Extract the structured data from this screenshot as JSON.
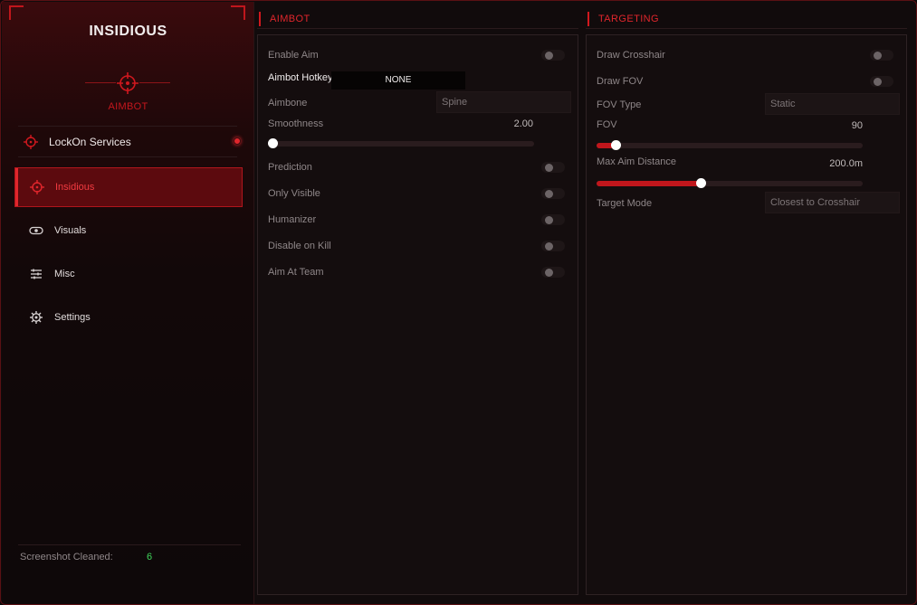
{
  "sidebar": {
    "brand": "INSIDIOUS",
    "logo_label": "AIMBOT",
    "service": {
      "label": "LockOn Services",
      "status_color": "#e0262c"
    },
    "nav": [
      {
        "label": "Insidious",
        "icon": "crosshair-icon",
        "active": true
      },
      {
        "label": "Visuals",
        "icon": "eye-icon",
        "active": false
      },
      {
        "label": "Misc",
        "icon": "sliders-icon",
        "active": false
      },
      {
        "label": "Settings",
        "icon": "gear-icon",
        "active": false
      }
    ],
    "footer": {
      "label": "Screenshot Cleaned:",
      "value": "6"
    }
  },
  "aimbot": {
    "title": "AIMBOT",
    "enable_aim": {
      "label": "Enable Aim",
      "on": false
    },
    "hotkey": {
      "label": "Aimbot Hotkey",
      "value": "NONE"
    },
    "aimbone": {
      "label": "Aimbone",
      "value": "Spine"
    },
    "smoothness": {
      "label": "Smoothness",
      "value": "2.00",
      "fraction": 0.0
    },
    "prediction": {
      "label": "Prediction",
      "on": false
    },
    "only_visible": {
      "label": "Only Visible",
      "on": false
    },
    "humanizer": {
      "label": "Humanizer",
      "on": false
    },
    "disable_on_kill": {
      "label": "Disable on Kill",
      "on": false
    },
    "aim_at_team": {
      "label": "Aim At Team",
      "on": false
    }
  },
  "targeting": {
    "title": "TARGETING",
    "draw_crosshair": {
      "label": "Draw Crosshair",
      "on": false
    },
    "draw_fov": {
      "label": "Draw FOV",
      "on": false
    },
    "fov_type": {
      "label": "FOV Type",
      "value": "Static"
    },
    "fov": {
      "label": "FOV",
      "value": "90",
      "fraction": 0.07
    },
    "max_aim_distance": {
      "label": "Max Aim Distance",
      "value": "200.0m",
      "fraction": 0.39
    },
    "target_mode": {
      "label": "Target Mode",
      "value": "Closest to Crosshair"
    }
  },
  "colors": {
    "accent": "#e0262c",
    "footer_value": "#3fd45a"
  }
}
